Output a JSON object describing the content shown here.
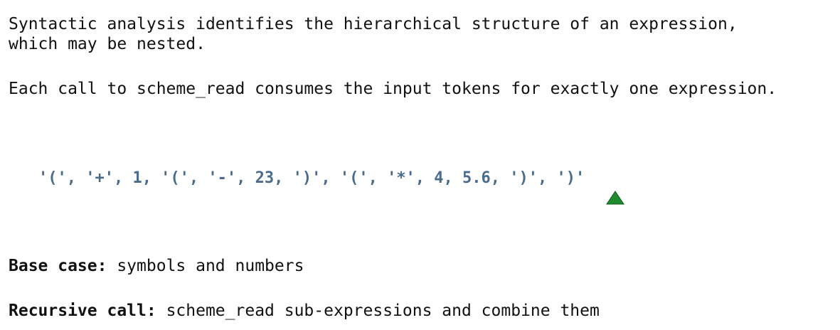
{
  "intro": {
    "line1": "Syntactic analysis identifies the hierarchical structure of an expression,",
    "line2": "which may be nested.",
    "line3": "Each call to scheme_read consumes the input tokens for exactly one expression."
  },
  "tokens": {
    "text": "'(', '+', 1, '(', '-', 23, ')', '(', '*', 4, 5.6, ')', ')'"
  },
  "marker": {
    "icon": "triangle-up-icon",
    "color": "#1f8a2e"
  },
  "cases": {
    "base_label": "Base case:",
    "base_text": " symbols and numbers",
    "recursive_label": "Recursive call:",
    "recursive_text": " scheme_read sub-expressions and combine them"
  }
}
